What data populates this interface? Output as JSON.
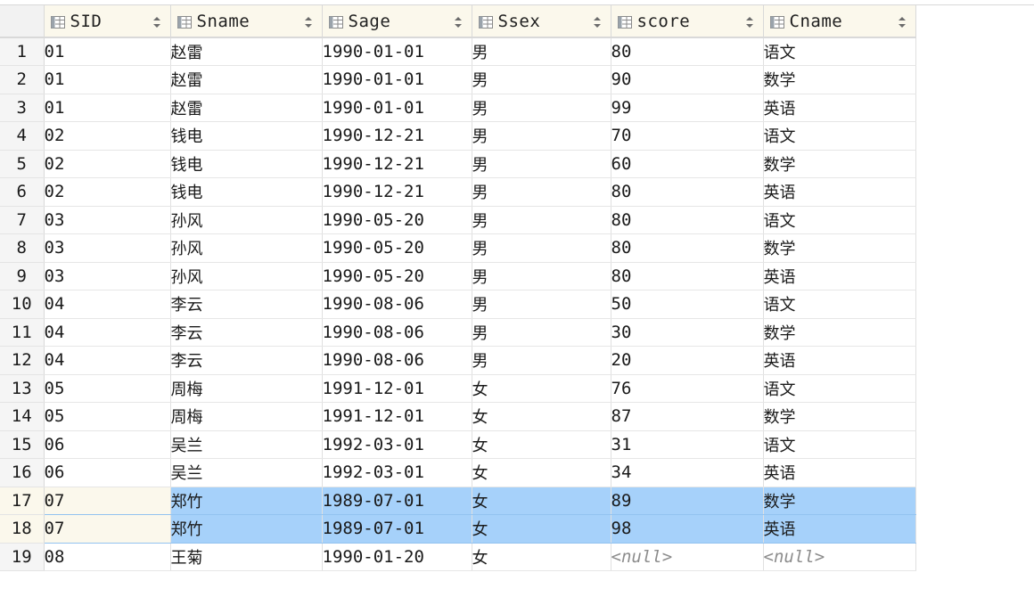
{
  "columns": [
    {
      "label": "SID",
      "icon": "column-icon"
    },
    {
      "label": "Sname",
      "icon": "column-icon"
    },
    {
      "label": "Sage",
      "icon": "column-icon"
    },
    {
      "label": "Ssex",
      "icon": "column-icon"
    },
    {
      "label": "score",
      "icon": "column-icon"
    },
    {
      "label": "Cname",
      "icon": "column-icon"
    }
  ],
  "rows": [
    {
      "num": "1",
      "cells": [
        "01",
        "赵雷",
        "1990-01-01",
        "男",
        "80",
        "语文"
      ]
    },
    {
      "num": "2",
      "cells": [
        "01",
        "赵雷",
        "1990-01-01",
        "男",
        "90",
        "数学"
      ]
    },
    {
      "num": "3",
      "cells": [
        "01",
        "赵雷",
        "1990-01-01",
        "男",
        "99",
        "英语"
      ]
    },
    {
      "num": "4",
      "cells": [
        "02",
        "钱电",
        "1990-12-21",
        "男",
        "70",
        "语文"
      ]
    },
    {
      "num": "5",
      "cells": [
        "02",
        "钱电",
        "1990-12-21",
        "男",
        "60",
        "数学"
      ]
    },
    {
      "num": "6",
      "cells": [
        "02",
        "钱电",
        "1990-12-21",
        "男",
        "80",
        "英语"
      ]
    },
    {
      "num": "7",
      "cells": [
        "03",
        "孙风",
        "1990-05-20",
        "男",
        "80",
        "语文"
      ]
    },
    {
      "num": "8",
      "cells": [
        "03",
        "孙风",
        "1990-05-20",
        "男",
        "80",
        "数学"
      ]
    },
    {
      "num": "9",
      "cells": [
        "03",
        "孙风",
        "1990-05-20",
        "男",
        "80",
        "英语"
      ]
    },
    {
      "num": "10",
      "cells": [
        "04",
        "李云",
        "1990-08-06",
        "男",
        "50",
        "语文"
      ]
    },
    {
      "num": "11",
      "cells": [
        "04",
        "李云",
        "1990-08-06",
        "男",
        "30",
        "数学"
      ]
    },
    {
      "num": "12",
      "cells": [
        "04",
        "李云",
        "1990-08-06",
        "男",
        "20",
        "英语"
      ]
    },
    {
      "num": "13",
      "cells": [
        "05",
        "周梅",
        "1991-12-01",
        "女",
        "76",
        "语文"
      ]
    },
    {
      "num": "14",
      "cells": [
        "05",
        "周梅",
        "1991-12-01",
        "女",
        "87",
        "数学"
      ]
    },
    {
      "num": "15",
      "cells": [
        "06",
        "吴兰",
        "1992-03-01",
        "女",
        "31",
        "语文"
      ]
    },
    {
      "num": "16",
      "cells": [
        "06",
        "吴兰",
        "1992-03-01",
        "女",
        "34",
        "英语"
      ]
    },
    {
      "num": "17",
      "cells": [
        "07",
        "郑竹",
        "1989-07-01",
        "女",
        "89",
        "数学"
      ],
      "selected": true
    },
    {
      "num": "18",
      "cells": [
        "07",
        "郑竹",
        "1989-07-01",
        "女",
        "98",
        "英语"
      ],
      "selected": true
    },
    {
      "num": "19",
      "cells": [
        "08",
        "王菊",
        "1990-01-20",
        "女",
        "<null>",
        "<null>"
      ]
    }
  ],
  "colors": {
    "header_bg": "#fbf8ec",
    "selection": "#a6d1fa",
    "null_text": "#8c8c8c"
  }
}
